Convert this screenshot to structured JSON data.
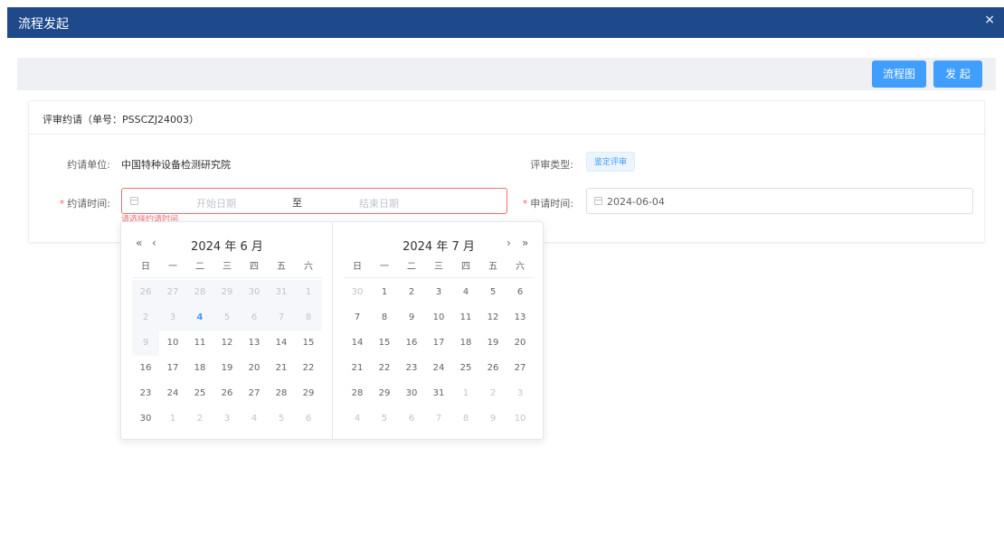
{
  "dialog": {
    "title": "流程发起",
    "close": "×"
  },
  "toolbar": {
    "flow_chart_label": "流程图",
    "start_label": "发 起"
  },
  "card": {
    "header": "评审约请（单号：PSSCZJ24003）",
    "unit_label": "约请单位:",
    "unit_value": "中国特种设备检测研究院",
    "type_label": "评审类型:",
    "type_tag": "鉴定评审",
    "invite_time_label": "约请时间:",
    "apply_time_label": "申请时间:",
    "start_placeholder": "开始日期",
    "range_separator": "至",
    "end_placeholder": "结束日期",
    "apply_time_value": "2024-06-04",
    "error_text": "请选择约请时间",
    "required_mark": "*"
  },
  "picker": {
    "weekdays": [
      "日",
      "一",
      "二",
      "三",
      "四",
      "五",
      "六"
    ],
    "left": {
      "title": "2024 年 6 月",
      "prev_year": "«",
      "prev_month": "‹",
      "rows": [
        [
          {
            "d": "26",
            "s": "d"
          },
          {
            "d": "27",
            "s": "d"
          },
          {
            "d": "28",
            "s": "d"
          },
          {
            "d": "29",
            "s": "d"
          },
          {
            "d": "30",
            "s": "d"
          },
          {
            "d": "31",
            "s": "d"
          },
          {
            "d": "1",
            "s": "d"
          }
        ],
        [
          {
            "d": "2",
            "s": "d"
          },
          {
            "d": "3",
            "s": "d"
          },
          {
            "d": "4",
            "s": "t"
          },
          {
            "d": "5",
            "s": "d"
          },
          {
            "d": "6",
            "s": "d"
          },
          {
            "d": "7",
            "s": "d"
          },
          {
            "d": "8",
            "s": "d"
          }
        ],
        [
          {
            "d": "9",
            "s": "d"
          },
          {
            "d": "10",
            "s": ""
          },
          {
            "d": "11",
            "s": ""
          },
          {
            "d": "12",
            "s": ""
          },
          {
            "d": "13",
            "s": ""
          },
          {
            "d": "14",
            "s": ""
          },
          {
            "d": "15",
            "s": ""
          }
        ],
        [
          {
            "d": "16",
            "s": ""
          },
          {
            "d": "17",
            "s": ""
          },
          {
            "d": "18",
            "s": ""
          },
          {
            "d": "19",
            "s": ""
          },
          {
            "d": "20",
            "s": ""
          },
          {
            "d": "21",
            "s": ""
          },
          {
            "d": "22",
            "s": ""
          }
        ],
        [
          {
            "d": "23",
            "s": ""
          },
          {
            "d": "24",
            "s": ""
          },
          {
            "d": "25",
            "s": ""
          },
          {
            "d": "26",
            "s": ""
          },
          {
            "d": "27",
            "s": ""
          },
          {
            "d": "28",
            "s": ""
          },
          {
            "d": "29",
            "s": ""
          }
        ],
        [
          {
            "d": "30",
            "s": ""
          },
          {
            "d": "1",
            "s": "o"
          },
          {
            "d": "2",
            "s": "o"
          },
          {
            "d": "3",
            "s": "o"
          },
          {
            "d": "4",
            "s": "o"
          },
          {
            "d": "5",
            "s": "o"
          },
          {
            "d": "6",
            "s": "o"
          }
        ]
      ]
    },
    "right": {
      "title": "2024 年 7 月",
      "next_month": "›",
      "next_year": "»",
      "rows": [
        [
          {
            "d": "30",
            "s": "o"
          },
          {
            "d": "1",
            "s": ""
          },
          {
            "d": "2",
            "s": ""
          },
          {
            "d": "3",
            "s": ""
          },
          {
            "d": "4",
            "s": ""
          },
          {
            "d": "5",
            "s": ""
          },
          {
            "d": "6",
            "s": ""
          }
        ],
        [
          {
            "d": "7",
            "s": ""
          },
          {
            "d": "8",
            "s": ""
          },
          {
            "d": "9",
            "s": ""
          },
          {
            "d": "10",
            "s": ""
          },
          {
            "d": "11",
            "s": ""
          },
          {
            "d": "12",
            "s": ""
          },
          {
            "d": "13",
            "s": ""
          }
        ],
        [
          {
            "d": "14",
            "s": ""
          },
          {
            "d": "15",
            "s": ""
          },
          {
            "d": "16",
            "s": ""
          },
          {
            "d": "17",
            "s": ""
          },
          {
            "d": "18",
            "s": ""
          },
          {
            "d": "19",
            "s": ""
          },
          {
            "d": "20",
            "s": ""
          }
        ],
        [
          {
            "d": "21",
            "s": ""
          },
          {
            "d": "22",
            "s": ""
          },
          {
            "d": "23",
            "s": ""
          },
          {
            "d": "24",
            "s": ""
          },
          {
            "d": "25",
            "s": ""
          },
          {
            "d": "26",
            "s": ""
          },
          {
            "d": "27",
            "s": ""
          }
        ],
        [
          {
            "d": "28",
            "s": ""
          },
          {
            "d": "29",
            "s": ""
          },
          {
            "d": "30",
            "s": ""
          },
          {
            "d": "31",
            "s": ""
          },
          {
            "d": "1",
            "s": "o"
          },
          {
            "d": "2",
            "s": "o"
          },
          {
            "d": "3",
            "s": "o"
          }
        ],
        [
          {
            "d": "4",
            "s": "o"
          },
          {
            "d": "5",
            "s": "o"
          },
          {
            "d": "6",
            "s": "o"
          },
          {
            "d": "7",
            "s": "o"
          },
          {
            "d": "8",
            "s": "o"
          },
          {
            "d": "9",
            "s": "o"
          },
          {
            "d": "10",
            "s": "o"
          }
        ]
      ]
    }
  }
}
